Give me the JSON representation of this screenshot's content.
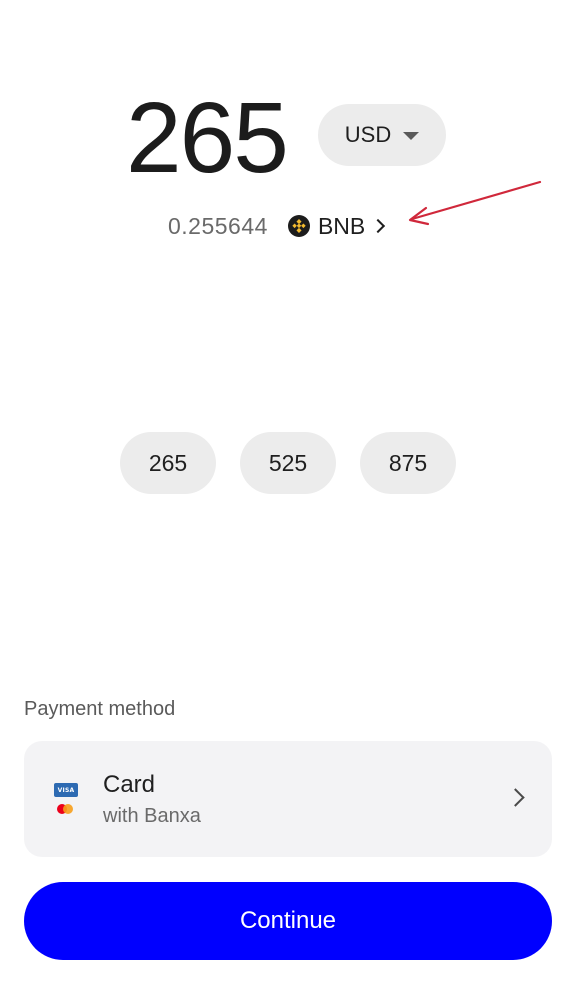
{
  "amount": {
    "value": "265"
  },
  "currency": {
    "selected": "USD",
    "icon": "caret-down-icon"
  },
  "conversion": {
    "crypto_amount": "0.255644",
    "crypto_symbol": "BNB",
    "crypto_icon": "bnb-icon"
  },
  "quick_amounts": [
    "265",
    "525",
    "875"
  ],
  "payment": {
    "label": "Payment method",
    "method_title": "Card",
    "method_subtitle": "with Banxa",
    "card_brand_text": "VISA"
  },
  "continue": {
    "label": "Continue",
    "color": "#0000ff"
  },
  "annotation": {
    "color": "#d0283b"
  }
}
